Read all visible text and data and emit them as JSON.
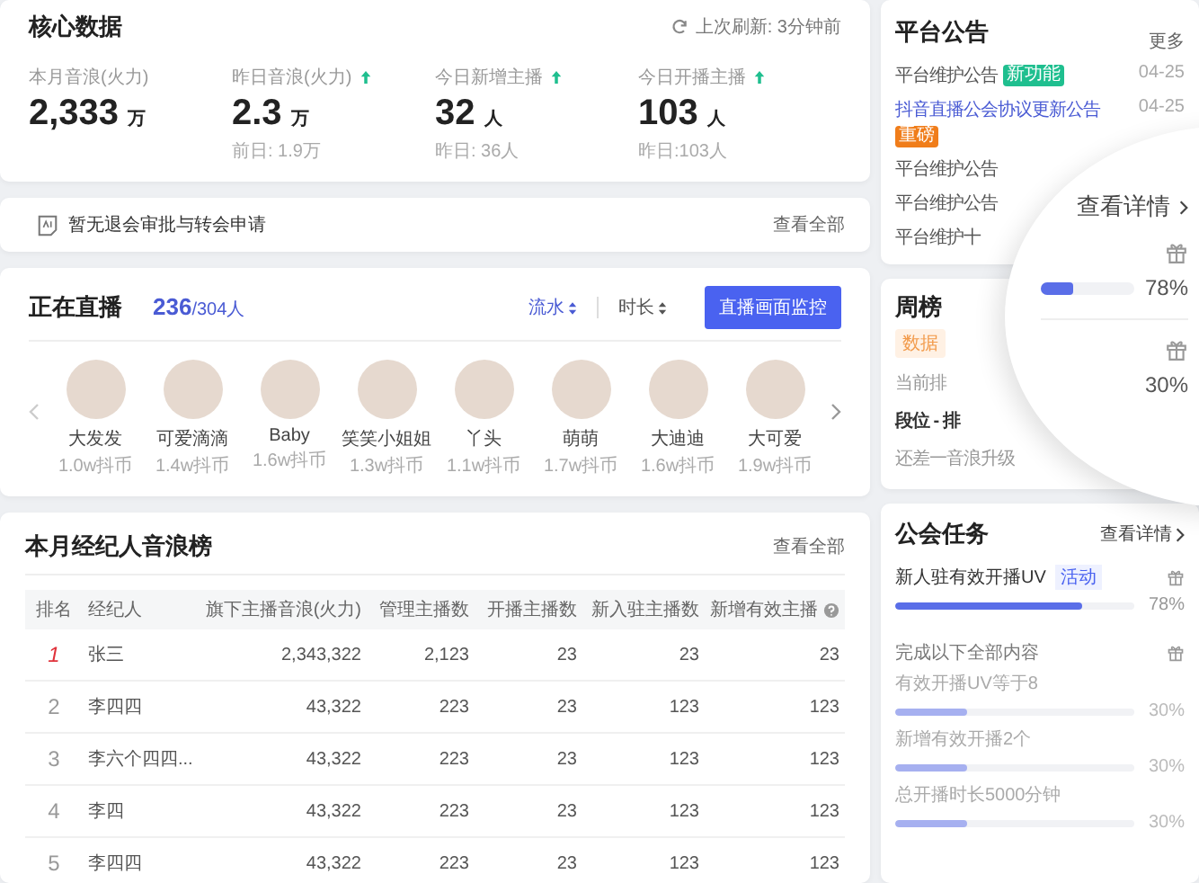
{
  "core_data": {
    "title": "核心数据",
    "refresh": "上次刷新: 3分钟前",
    "metrics": [
      {
        "label": "本月音浪(火力)",
        "trend_up": false,
        "value": "2,333",
        "unit": "万"
      },
      {
        "label": "昨日音浪(火力)",
        "trend_up": true,
        "value": "2.3",
        "unit": "万",
        "compare": "前日: 1.9万"
      },
      {
        "label": "今日新增主播",
        "trend_up": true,
        "value": "32",
        "unit": "人",
        "compare": "昨日: 36人"
      },
      {
        "label": "今日开播主播",
        "trend_up": true,
        "value": "103",
        "unit": "人",
        "compare": "昨日:103人"
      }
    ]
  },
  "notice_bar": {
    "text": "暂无退会审批与转会申请",
    "link": "查看全部"
  },
  "live": {
    "title": "正在直播",
    "count": "236",
    "total": "/304人",
    "sort": [
      {
        "label": "流水",
        "selected": true
      },
      {
        "label": "时长",
        "selected": false
      }
    ],
    "button": "直播画面监控",
    "streamers": [
      {
        "name": "大发发",
        "coins": "1.0w抖币"
      },
      {
        "name": "可爱滴滴",
        "coins": "1.4w抖币"
      },
      {
        "name": "Baby",
        "coins": "1.6w抖币"
      },
      {
        "name": "笑笑小姐姐",
        "coins": "1.3w抖币"
      },
      {
        "name": "丫头",
        "coins": "1.1w抖币"
      },
      {
        "name": "萌萌",
        "coins": "1.7w抖币"
      },
      {
        "name": "大迪迪",
        "coins": "1.6w抖币"
      },
      {
        "name": "大可爱",
        "coins": "1.9w抖币"
      }
    ]
  },
  "ranking": {
    "title": "本月经纪人音浪榜",
    "link": "查看全部",
    "columns": [
      {
        "label": "排名",
        "help": false
      },
      {
        "label": "经纪人",
        "help": false
      },
      {
        "label": "旗下主播音浪(火力)",
        "help": false
      },
      {
        "label": "管理主播数",
        "help": false
      },
      {
        "label": "开播主播数",
        "help": false
      },
      {
        "label": "新入驻主播数",
        "help": false
      },
      {
        "label": "新增有效主播",
        "help": true
      }
    ],
    "rows": [
      {
        "highlighted": true,
        "cells": [
          "1",
          "张三",
          "2,343,322",
          "2,123",
          "23",
          "23",
          "23"
        ]
      },
      {
        "highlighted": false,
        "cells": [
          "2",
          "李四四",
          "43,322",
          "223",
          "23",
          "123",
          "123"
        ]
      },
      {
        "highlighted": false,
        "cells": [
          "3",
          "李六个四四...",
          "43,322",
          "223",
          "23",
          "123",
          "123"
        ]
      },
      {
        "highlighted": false,
        "cells": [
          "4",
          "李四",
          "43,322",
          "223",
          "23",
          "123",
          "123"
        ]
      },
      {
        "highlighted": false,
        "cells": [
          "5",
          "李四四",
          "43,322",
          "223",
          "23",
          "123",
          "123"
        ]
      }
    ]
  },
  "announcements": {
    "title": "平台公告",
    "more": "更多",
    "items": [
      {
        "text": "平台维护公告",
        "highlighted": false,
        "tag": {
          "text": "新功能",
          "color": "#1fbf8f"
        },
        "date": "04-25"
      },
      {
        "text": "抖音直播公会协议更新公告",
        "highlighted": true,
        "tag": {
          "text": "重磅",
          "color": "#f07d1a"
        },
        "date": "04-25"
      },
      {
        "text": "平台维护公告",
        "highlighted": false
      },
      {
        "text": "平台维护公告",
        "highlighted": false
      },
      {
        "text": "平台维护十",
        "highlighted": false
      }
    ]
  },
  "weekly": {
    "title": "周榜",
    "badge": "数据",
    "lines": [
      {
        "text": "当前排",
        "bold": false
      },
      {
        "text": "段位 - 排",
        "bold": true
      },
      {
        "text": "还差一音浪升级",
        "bold": false
      }
    ]
  },
  "magnifier": {
    "link": "查看详情",
    "items": [
      {
        "level": 0.35,
        "reading": "78%"
      },
      {
        "reading": "30%"
      }
    ]
  },
  "guild_tasks": {
    "title": "公会任务",
    "link": "查看详情",
    "tasks": [
      {
        "kind": "single",
        "name": "新人驻有效开播UV",
        "tag": "活动",
        "level": 0.78,
        "reading": "78%"
      },
      {
        "kind": "group",
        "name": "完成以下全部内容",
        "subtasks": [
          {
            "name": "有效开播UV等于8",
            "level": 0.3,
            "reading": "30%"
          },
          {
            "name": "新增有效开播2个",
            "level": 0.3,
            "reading": "30%"
          },
          {
            "name": "总开播时长5000分钟",
            "level": 0.3,
            "reading": "30%"
          }
        ]
      }
    ]
  }
}
